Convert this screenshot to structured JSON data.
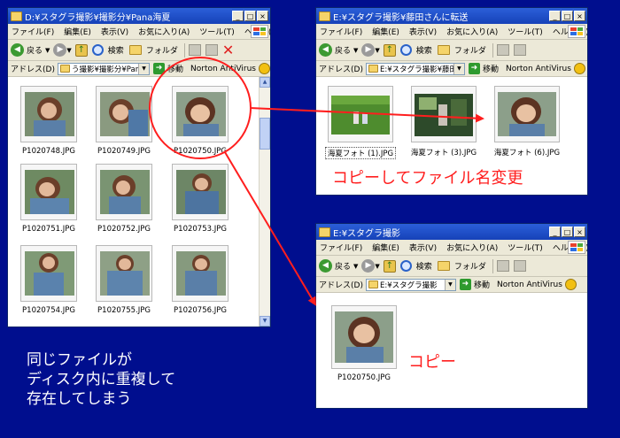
{
  "windows": {
    "source": {
      "title": "D:¥スタグラ撮影¥撮影分¥Pana海夏",
      "address": "う撮影¥撮影分¥Pana海夏",
      "files": [
        "P1020748.JPG",
        "P1020749.JPG",
        "P1020750.JPG",
        "P1020751.JPG",
        "P1020752.JPG",
        "P1020753.JPG",
        "P1020754.JPG",
        "P1020755.JPG",
        "P1020756.JPG"
      ]
    },
    "renamed": {
      "title": "E:¥スタグラ撮影¥藤田さんに転送",
      "address": "E:¥スタグラ撮影¥藤田",
      "files": [
        "海夏フォト (1).JPG",
        "海夏フォト (3).JPG",
        "海夏フォト (6).JPG"
      ]
    },
    "copied": {
      "title": "E:¥スタグラ撮影",
      "address": "E:¥スタグラ撮影",
      "files": [
        "P1020750.JPG"
      ]
    }
  },
  "menu": {
    "file": "ファイル(F)",
    "edit": "編集(E)",
    "view": "表示(V)",
    "favorites": "お気に入り(A)",
    "tools": "ツール(T)",
    "help": "ヘルプ(H)"
  },
  "toolbar": {
    "back": "戻る",
    "search": "検索",
    "folders": "フォルダ"
  },
  "address_label": "アドレス(D)",
  "go_label": "移動",
  "norton_label": "Norton AntiVirus",
  "annotations": {
    "rename_note": "コピーしてファイル名変更",
    "copy_note": "コピー",
    "duplicate_note_line1": "同じファイルが",
    "duplicate_note_line2": "ディスク内に重複して",
    "duplicate_note_line3": "存在してしまう"
  },
  "colors": {
    "desktop": "#000e8e",
    "titlebar": "#1d4fc9",
    "annotation_red": "#ff1e1e",
    "annotation_white": "#ffffff"
  }
}
